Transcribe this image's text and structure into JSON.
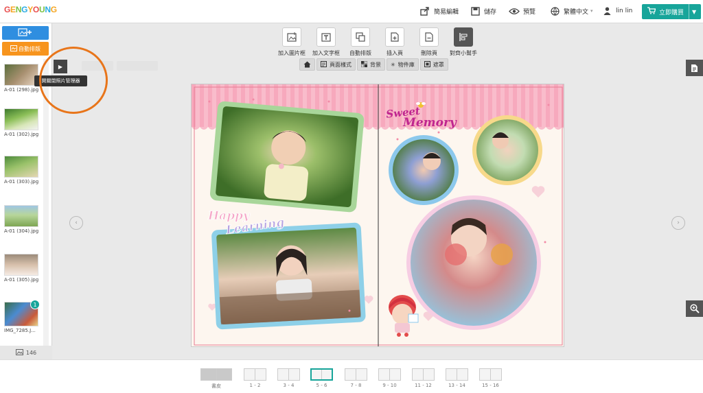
{
  "header": {
    "logo": [
      "G",
      "E",
      "N",
      "G",
      "Y",
      "O",
      "U",
      "N",
      "G"
    ],
    "logo_colors": [
      "#e94e4e",
      "#f5a623",
      "#7ac143",
      "#29abe2",
      "#f5a623",
      "#e94e4e",
      "#7ac143",
      "#29abe2",
      "#f5a623"
    ],
    "items": [
      "簡易編輯",
      "儲存",
      "預覽",
      "繁體中文",
      "lin lin"
    ],
    "buy_label": "立即購買"
  },
  "sidebar": {
    "auto_layout": "自動排版",
    "thumbs": [
      {
        "caption": "A-01 (298).jpg"
      },
      {
        "caption": "A-01 (302).jpg"
      },
      {
        "caption": "A-01 (303).jpg"
      },
      {
        "caption": "A-01 (304).jpg"
      },
      {
        "caption": "A-01 (305).jpg"
      },
      {
        "caption": "IMG_7285.J...",
        "badge": "1"
      }
    ],
    "count": "146"
  },
  "tooltip": "開關閉照片管理器",
  "toolbar": {
    "tools": [
      "加入圖片框",
      "加入文字框",
      "自動排版",
      "插入頁",
      "刪除頁",
      "對齊小幫手"
    ]
  },
  "subtabs": [
    "頁面樣式",
    "背景",
    "物件庫",
    "遮罩"
  ],
  "page": {
    "title_sweet": "Sweet",
    "title_memory": "Memory",
    "happy": "Happy",
    "learning": "Learning"
  },
  "pages": [
    "書皮",
    "1 - 2",
    "3 - 4",
    "5 - 6",
    "7 - 8",
    "9 - 10",
    "11 - 12",
    "13 - 14",
    "15 - 16"
  ],
  "colors": {
    "accent": "#17a59a",
    "blue_btn": "#2f8ee0",
    "orange_btn": "#f7941d",
    "highlight": "#e8751a"
  }
}
